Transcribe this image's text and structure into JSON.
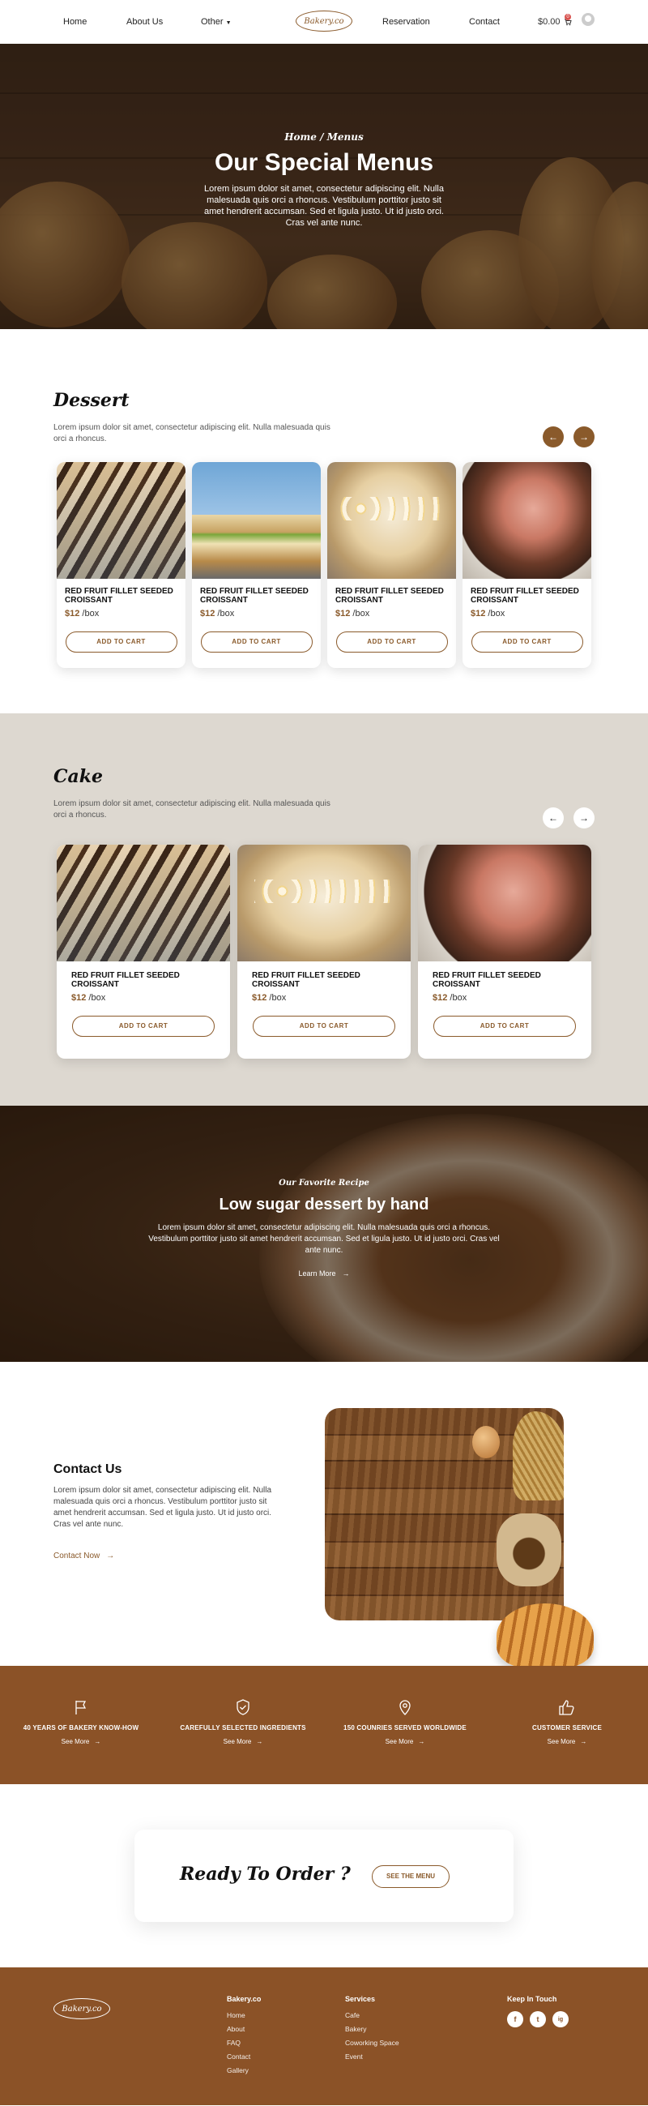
{
  "nav": {
    "home": "Home",
    "about": "About Us",
    "other": "Other",
    "logo": "Bakery.co",
    "reservation": "Reservation",
    "contact": "Contact",
    "cart_total": "$0.00",
    "cart_count": "0"
  },
  "hero": {
    "breadcrumb": "Home / Menus",
    "title": "Our Special Menus",
    "text": "Lorem ipsum dolor sit amet, consectetur adipiscing elit. Nulla malesuada quis orci a rhoncus. Vestibulum porttitor justo sit amet hendrerit accumsan. Sed et ligula justo. Ut id justo orci. Cras vel ante nunc."
  },
  "dessert": {
    "title": "Dessert",
    "desc": "Lorem ipsum dolor sit amet, consectetur adipiscing elit. Nulla malesuada quis orci a rhoncus.",
    "cards": [
      {
        "name": "RED FRUIT FILLET SEEDED CROISSANT",
        "price": "$12",
        "unit": " /box",
        "button": "ADD TO CART"
      },
      {
        "name": "RED FRUIT FILLET SEEDED CROISSANT",
        "price": "$12",
        "unit": " /box",
        "button": "ADD TO CART"
      },
      {
        "name": "RED FRUIT FILLET SEEDED CROISSANT",
        "price": "$12",
        "unit": " /box",
        "button": "ADD TO CART"
      },
      {
        "name": "RED FRUIT FILLET SEEDED CROISSANT",
        "price": "$12",
        "unit": " /box",
        "button": "ADD TO CART"
      }
    ]
  },
  "cake": {
    "title": "Cake",
    "desc": "Lorem ipsum dolor sit amet, consectetur adipiscing elit. Nulla malesuada quis orci a rhoncus.",
    "cards": [
      {
        "name": "RED FRUIT FILLET SEEDED CROISSANT",
        "price": "$12",
        "unit": " /box",
        "button": "ADD TO CART"
      },
      {
        "name": "RED FRUIT FILLET SEEDED CROISSANT",
        "price": "$12",
        "unit": " /box",
        "button": "ADD TO CART"
      },
      {
        "name": "RED FRUIT FILLET SEEDED CROISSANT",
        "price": "$12",
        "unit": " /box",
        "button": "ADD TO CART"
      }
    ]
  },
  "recipe": {
    "sub": "Our Favorite Recipe",
    "title": "Low sugar dessert by hand",
    "text": "Lorem ipsum dolor sit amet, consectetur adipiscing elit. Nulla malesuada quis orci a rhoncus. Vestibulum porttitor justo sit amet hendrerit accumsan. Sed et ligula justo. Ut id justo orci. Cras vel ante nunc.",
    "link": "Learn More"
  },
  "contact": {
    "title": "Contact Us",
    "text": "Lorem ipsum dolor sit amet, consectetur adipiscing elit. Nulla malesuada quis orci a rhoncus. Vestibulum porttitor justo sit amet hendrerit accumsan. Sed et ligula justo. Ut id justo orci. Cras vel ante nunc.",
    "link": "Contact Now"
  },
  "features": [
    {
      "title": "40 YEARS OF BAKERY KNOW-HOW",
      "more": "See More",
      "icon": "flag-icon"
    },
    {
      "title": "CAREFULLY SELECTED INGREDIENTS",
      "more": "See More",
      "icon": "shield-check-icon"
    },
    {
      "title": "150 COUNRIES SERVED WORLDWIDE",
      "more": "See More",
      "icon": "map-pin-icon"
    },
    {
      "title": "CUSTOMER SERVICE",
      "more": "See More",
      "icon": "thumbs-up-icon"
    }
  ],
  "order": {
    "text": "Ready To Order ?",
    "button": "SEE THE MENU"
  },
  "footer": {
    "logo": "Bakery.co",
    "col1_head": "Bakery.co",
    "col1": [
      "Home",
      "About",
      "FAQ",
      "Contact",
      "Gallery"
    ],
    "col2_head": "Services",
    "col2": [
      "Cafe",
      "Bakery",
      "Coworking Space",
      "Event"
    ],
    "col3_head": "Keep In Touch",
    "socials": [
      "f",
      "t",
      "ig"
    ]
  },
  "colors": {
    "accent": "#8a5a2b",
    "brown_bar": "#8b5227",
    "cake_bg": "#ddd8d0"
  }
}
